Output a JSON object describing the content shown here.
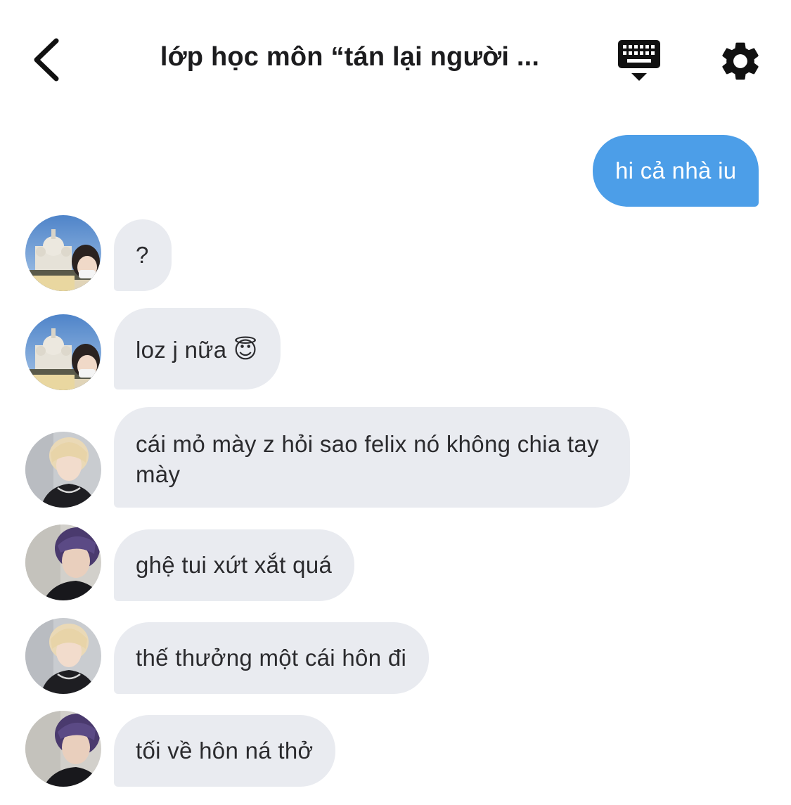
{
  "header": {
    "title": "lớp học môn “tán lại người ...",
    "back_icon": "chevron-left-icon",
    "keyboard_icon": "keyboard-icon",
    "settings_icon": "gear-icon"
  },
  "colors": {
    "sent_bubble": "#4c9ee8",
    "received_bubble": "#e9ebf0",
    "text": "#1c1c1e"
  },
  "messages": [
    {
      "direction": "sent",
      "text": "hi cả nhà iu"
    },
    {
      "direction": "received",
      "avatar": "avatar-cathedral",
      "text": "?"
    },
    {
      "direction": "received",
      "avatar": "avatar-cathedral",
      "text": "loz j nữa 😇"
    },
    {
      "direction": "received",
      "avatar": "avatar-blond",
      "text": "cái mỏ mày z hỏi sao felix nó không chia tay mày"
    },
    {
      "direction": "received",
      "avatar": "avatar-purple-hair",
      "text": "ghệ tui xứt xắt quá"
    },
    {
      "direction": "received",
      "avatar": "avatar-blond",
      "text": "thế thưởng một cái hôn đi"
    },
    {
      "direction": "received",
      "avatar": "avatar-purple-hair",
      "text": "tối về hôn ná thở"
    }
  ]
}
